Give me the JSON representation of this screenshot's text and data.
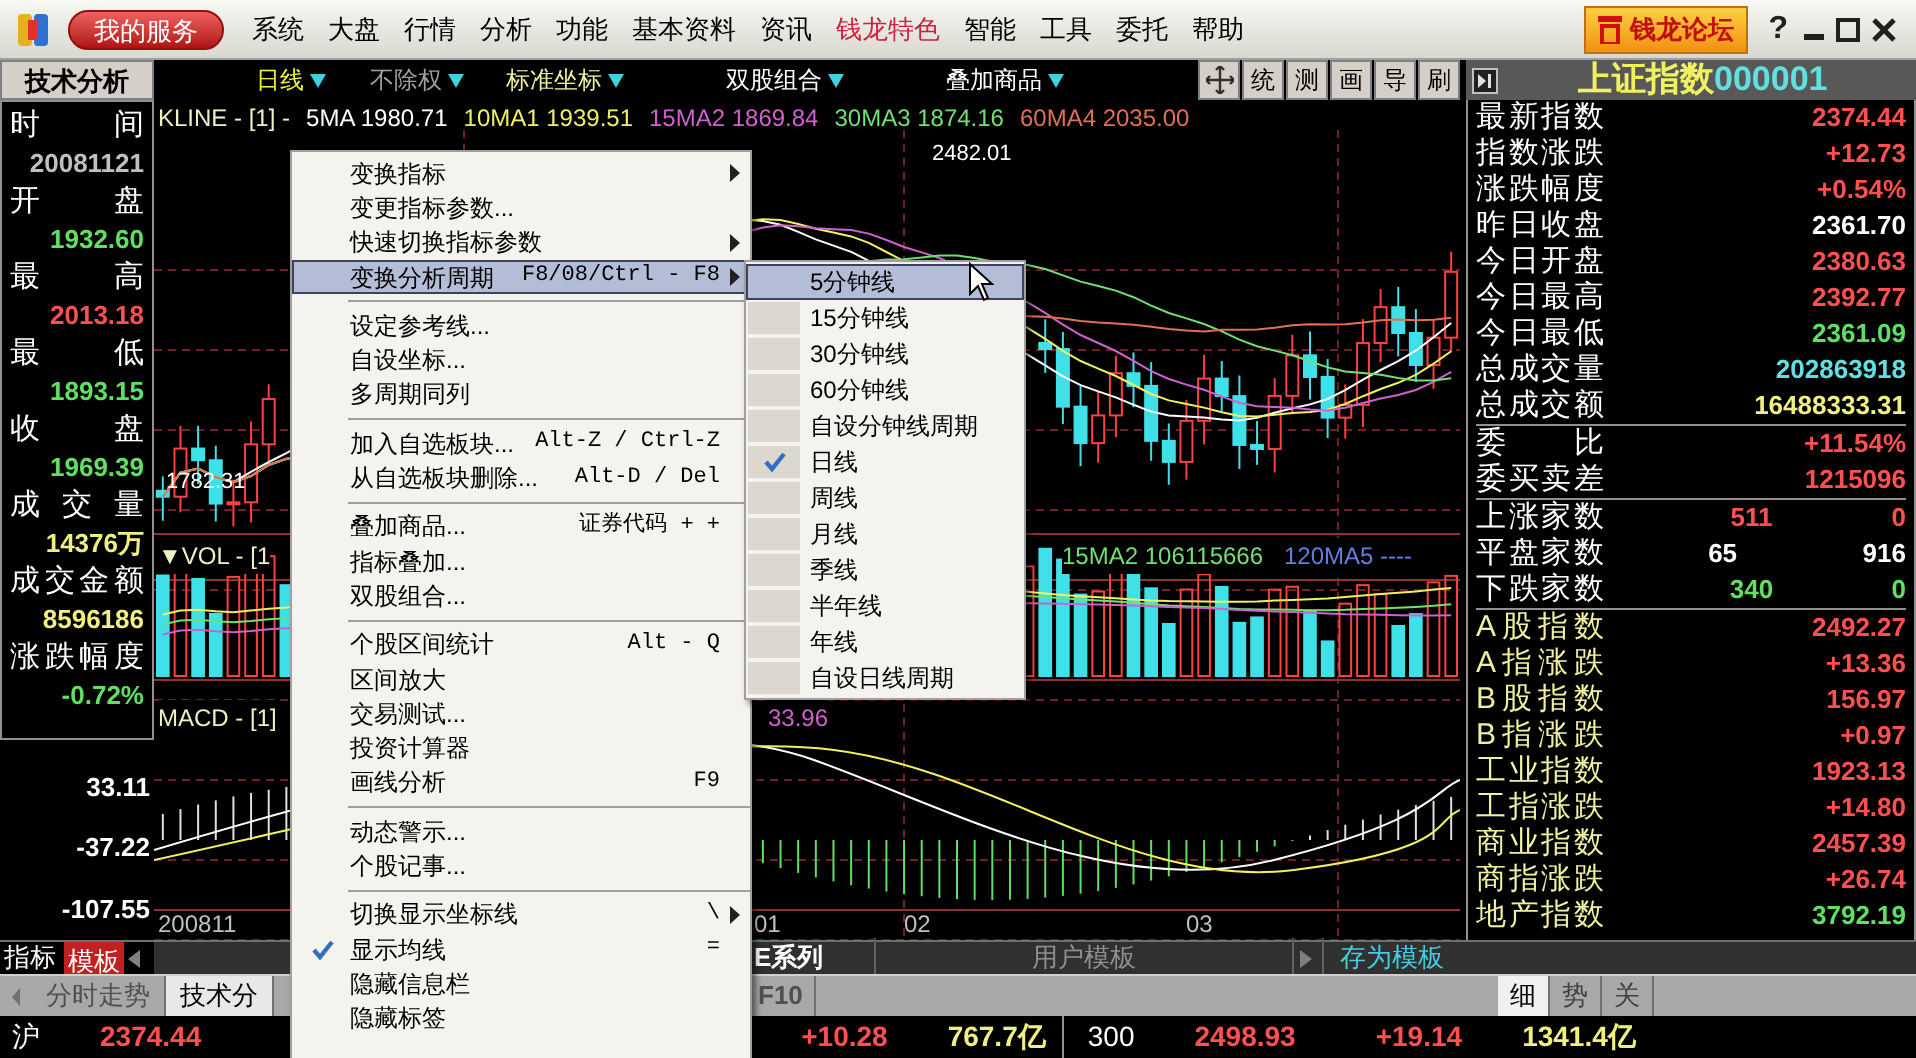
{
  "title_bar": {
    "service_button": "我的服务",
    "menu": [
      {
        "label": "系统",
        "highlighted": false
      },
      {
        "label": "大盘",
        "highlighted": false
      },
      {
        "label": "行情",
        "highlighted": false
      },
      {
        "label": "分析",
        "highlighted": false
      },
      {
        "label": "功能",
        "highlighted": false
      },
      {
        "label": "基本资料",
        "highlighted": false
      },
      {
        "label": "资讯",
        "highlighted": false
      },
      {
        "label": "钱龙特色",
        "highlighted": true
      },
      {
        "label": "智能",
        "highlighted": false
      },
      {
        "label": "工具",
        "highlighted": false
      },
      {
        "label": "委托",
        "highlighted": false
      },
      {
        "label": "帮助",
        "highlighted": false
      }
    ],
    "forum_button": "钱龙论坛",
    "help_button": "?"
  },
  "toolbar": {
    "view_tab": "技术分析",
    "dropdowns": [
      {
        "label": "日线",
        "color": "#f0f040"
      },
      {
        "label": "不除权",
        "color": "#a0a0a0"
      },
      {
        "label": "标准坐标",
        "color": "#f0f0a0"
      },
      {
        "label": "双股组合",
        "color": "#ffffff"
      },
      {
        "label": "叠加商品",
        "color": "#ffffff"
      }
    ],
    "tools": [
      "统",
      "测",
      "画",
      "导",
      "刷"
    ]
  },
  "quote_header": {
    "name": "上证指数",
    "code": "000001"
  },
  "info_panel": {
    "items": [
      {
        "label": "时间",
        "value": "20081121",
        "color": "#c0c0c0"
      },
      {
        "label": "开盘",
        "value": "1932.60",
        "color": "#60e060"
      },
      {
        "label": "最高",
        "value": "2013.18",
        "color": "#ff5050"
      },
      {
        "label": "最低",
        "value": "1893.15",
        "color": "#60e060"
      },
      {
        "label": "收盘",
        "value": "1969.39",
        "color": "#60e060"
      },
      {
        "label": "成交量",
        "value": "14376万",
        "color": "#f0f080"
      },
      {
        "label": "成交金额",
        "value": "8596186",
        "color": "#f0f080"
      },
      {
        "label": "涨跌幅度",
        "value": "-0.72%",
        "color": "#60e060"
      }
    ],
    "axis_ticks": [
      "33.11",
      "-37.22",
      "-107.55"
    ]
  },
  "chart": {
    "price_legend": [
      {
        "text": "KLINE - [1] -",
        "color": "#f0f0c0"
      },
      {
        "text": "5MA 1980.71",
        "color": "#ffffff"
      },
      {
        "text": "10MA1 1939.51",
        "color": "#f0f060"
      },
      {
        "text": "15MA2 1869.84",
        "color": "#d060d0"
      },
      {
        "text": "30MA3 1874.16",
        "color": "#70e070"
      },
      {
        "text": "60MA4 2035.00",
        "color": "#e07050"
      }
    ],
    "high_label": "2482.01",
    "low_label": "1782.31",
    "volume_legend": [
      {
        "text": "▼VOL - [1",
        "color": "#f0f0c0"
      },
      {
        "text": "15MA2 106115666",
        "color": "#70e070"
      },
      {
        "text": "120MA5 ----",
        "color": "#6080e0"
      }
    ],
    "macd_legend": [
      {
        "text": "MACD - [1]",
        "color": "#f0f0c0"
      },
      {
        "text": "33.96",
        "color": "#d060d0"
      }
    ],
    "dates": [
      "200811",
      "01",
      "02",
      "03"
    ]
  },
  "quote_panel": {
    "sections": [
      [
        {
          "label": {
            "text": "最新指数",
            "color": "#ffffff"
          },
          "values": [
            {
              "text": "2374.44",
              "color": "#ff5050"
            }
          ]
        },
        {
          "label": {
            "text": "指数涨跌",
            "color": "#ffffff"
          },
          "values": [
            {
              "text": "+12.73",
              "color": "#ff5050"
            }
          ]
        },
        {
          "label": {
            "text": "涨跌幅度",
            "color": "#ffffff"
          },
          "values": [
            {
              "text": "+0.54%",
              "color": "#ff5050"
            }
          ]
        },
        {
          "label": {
            "text": "昨日收盘",
            "color": "#ffffff"
          },
          "values": [
            {
              "text": "2361.70",
              "color": "#ffffff"
            }
          ]
        },
        {
          "label": {
            "text": "今日开盘",
            "color": "#ffffff"
          },
          "values": [
            {
              "text": "2380.63",
              "color": "#ff5050"
            }
          ]
        },
        {
          "label": {
            "text": "今日最高",
            "color": "#ffffff"
          },
          "values": [
            {
              "text": "2392.77",
              "color": "#ff5050"
            }
          ]
        },
        {
          "label": {
            "text": "今日最低",
            "color": "#ffffff"
          },
          "values": [
            {
              "text": "2361.09",
              "color": "#60e060"
            }
          ]
        },
        {
          "label": {
            "text": "总成交量",
            "color": "#ffffff"
          },
          "values": [
            {
              "text": "202863918",
              "color": "#60e0e0"
            }
          ]
        },
        {
          "label": {
            "text": "总成交额",
            "color": "#ffffff"
          },
          "values": [
            {
              "text": "16488333.31",
              "color": "#f0f080"
            }
          ]
        }
      ],
      [
        {
          "label": {
            "text": "委比",
            "color": "#ffffff"
          },
          "values": [
            {
              "text": "+11.54%",
              "color": "#ff5050"
            }
          ]
        },
        {
          "label": {
            "text": "委买卖差",
            "color": "#ffffff"
          },
          "values": [
            {
              "text": "1215096",
              "color": "#ff5050"
            }
          ]
        }
      ],
      [
        {
          "label": {
            "text": "上涨家数",
            "color": "#ffffff"
          },
          "values": [
            {
              "text": "511",
              "color": "#ff5050"
            },
            {
              "text": "0",
              "color": "#ff5050"
            }
          ]
        },
        {
          "label": {
            "text": "平盘家数",
            "color": "#ffffff"
          },
          "values": [
            {
              "text": "65",
              "color": "#ffffff"
            },
            {
              "text": "916",
              "color": "#ffffff"
            }
          ]
        },
        {
          "label": {
            "text": "下跌家数",
            "color": "#ffffff"
          },
          "values": [
            {
              "text": "340",
              "color": "#60e060"
            },
            {
              "text": "0",
              "color": "#60e060"
            }
          ]
        }
      ],
      [
        {
          "label": {
            "text": "A股指数",
            "color": "#f0f0a0"
          },
          "values": [
            {
              "text": "2492.27",
              "color": "#ff5050"
            }
          ]
        },
        {
          "label": {
            "text": "A指涨跌",
            "color": "#f0f0a0"
          },
          "values": [
            {
              "text": "+13.36",
              "color": "#ff5050"
            }
          ]
        },
        {
          "label": {
            "text": "B股指数",
            "color": "#f0f0a0"
          },
          "values": [
            {
              "text": "156.97",
              "color": "#ff5050"
            }
          ]
        },
        {
          "label": {
            "text": "B指涨跌",
            "color": "#f0f0a0"
          },
          "values": [
            {
              "text": "+0.97",
              "color": "#ff5050"
            }
          ]
        },
        {
          "label": {
            "text": "工业指数",
            "color": "#f0f0a0"
          },
          "values": [
            {
              "text": "1923.13",
              "color": "#ff5050"
            }
          ]
        },
        {
          "label": {
            "text": "工指涨跌",
            "color": "#f0f0a0"
          },
          "values": [
            {
              "text": "+14.80",
              "color": "#ff5050"
            }
          ]
        },
        {
          "label": {
            "text": "商业指数",
            "color": "#f0f0a0"
          },
          "values": [
            {
              "text": "2457.39",
              "color": "#ff5050"
            }
          ]
        },
        {
          "label": {
            "text": "商指涨跌",
            "color": "#f0f0a0"
          },
          "values": [
            {
              "text": "+26.74",
              "color": "#ff5050"
            }
          ]
        },
        {
          "label": {
            "text": "地产指数",
            "color": "#f0f0a0"
          },
          "values": [
            {
              "text": "3792.19",
              "color": "#60e060"
            }
          ]
        }
      ]
    ],
    "tabs": [
      {
        "label": "细",
        "selected": true
      },
      {
        "label": "势",
        "selected": false
      },
      {
        "label": "关",
        "selected": false
      }
    ]
  },
  "template_bar": {
    "indicator_label": "指标",
    "template_button": "模板",
    "series_label": "E系列",
    "user_templates": "用户模板",
    "save_button": "存为模板"
  },
  "view_tabs": [
    {
      "label": "分时走势",
      "selected": false
    },
    {
      "label": "技术分",
      "selected": true
    }
  ],
  "f10_button": "F10",
  "status_bar": {
    "market": "沪",
    "index": "2374.44",
    "change": "+10.28",
    "turnover": "767.7亿",
    "code": "300",
    "index2": "2498.93",
    "change2": "+19.14",
    "turnover2": "1341.4亿"
  },
  "context_menu": {
    "groups": [
      [
        {
          "label": "变换指标",
          "submenu": true,
          "checked": false,
          "selected": false
        },
        {
          "label": "变更指标参数...",
          "submenu": false,
          "checked": false,
          "selected": false
        },
        {
          "label": "快速切换指标参数",
          "submenu": true,
          "checked": false,
          "selected": false
        },
        {
          "label": "变换分析周期",
          "shortcut": "F8/08/Ctrl - F8",
          "submenu": true,
          "checked": false,
          "selected": true
        }
      ],
      [
        {
          "label": "设定参考线...",
          "submenu": false,
          "checked": false,
          "selected": false
        },
        {
          "label": "自设坐标...",
          "submenu": false,
          "checked": false,
          "selected": false
        },
        {
          "label": "多周期同列",
          "submenu": false,
          "checked": false,
          "selected": false
        }
      ],
      [
        {
          "label": "加入自选板块...",
          "shortcut": "Alt-Z / Ctrl-Z",
          "submenu": false,
          "checked": false,
          "selected": false
        },
        {
          "label": "从自选板块删除...",
          "shortcut": "Alt-D / Del",
          "submenu": false,
          "checked": false,
          "selected": false
        }
      ],
      [
        {
          "label": "叠加商品...",
          "shortcut": "证券代码 + +",
          "submenu": false,
          "checked": false,
          "selected": false
        },
        {
          "label": "指标叠加...",
          "submenu": false,
          "checked": false,
          "selected": false
        },
        {
          "label": "双股组合...",
          "submenu": false,
          "checked": false,
          "selected": false
        }
      ],
      [
        {
          "label": "个股区间统计",
          "shortcut": "Alt - Q",
          "submenu": false,
          "checked": false,
          "selected": false
        },
        {
          "label": "区间放大",
          "submenu": false,
          "checked": false,
          "selected": false
        },
        {
          "label": "交易测试...",
          "submenu": false,
          "checked": false,
          "selected": false
        },
        {
          "label": "投资计算器",
          "submenu": false,
          "checked": false,
          "selected": false
        },
        {
          "label": "画线分析",
          "shortcut": "F9",
          "submenu": false,
          "checked": false,
          "selected": false
        }
      ],
      [
        {
          "label": "动态警示...",
          "submenu": false,
          "checked": false,
          "selected": false
        },
        {
          "label": "个股记事...",
          "submenu": false,
          "checked": false,
          "selected": false
        }
      ],
      [
        {
          "label": "切换显示坐标线",
          "shortcut": "\\",
          "submenu": true,
          "checked": false,
          "selected": false
        },
        {
          "label": "显示均线",
          "shortcut": "=",
          "submenu": false,
          "checked": true,
          "selected": false
        },
        {
          "label": "隐藏信息栏",
          "submenu": false,
          "checked": false,
          "selected": false
        },
        {
          "label": "隐藏标签",
          "submenu": false,
          "checked": false,
          "selected": false
        }
      ]
    ]
  },
  "period_submenu": {
    "items": [
      {
        "label": "5分钟线",
        "checked": false,
        "selected": true
      },
      {
        "label": "15分钟线",
        "checked": false,
        "selected": false
      },
      {
        "label": "30分钟线",
        "checked": false,
        "selected": false
      },
      {
        "label": "60分钟线",
        "checked": false,
        "selected": false
      },
      {
        "label": "自设分钟线周期",
        "checked": false,
        "selected": false
      },
      {
        "label": "日线",
        "checked": true,
        "selected": false
      },
      {
        "label": "周线",
        "checked": false,
        "selected": false
      },
      {
        "label": "月线",
        "checked": false,
        "selected": false
      },
      {
        "label": "季线",
        "checked": false,
        "selected": false
      },
      {
        "label": "半年线",
        "checked": false,
        "selected": false
      },
      {
        "label": "年线",
        "checked": false,
        "selected": false
      },
      {
        "label": "自设日线周期",
        "checked": false,
        "selected": false
      }
    ]
  }
}
